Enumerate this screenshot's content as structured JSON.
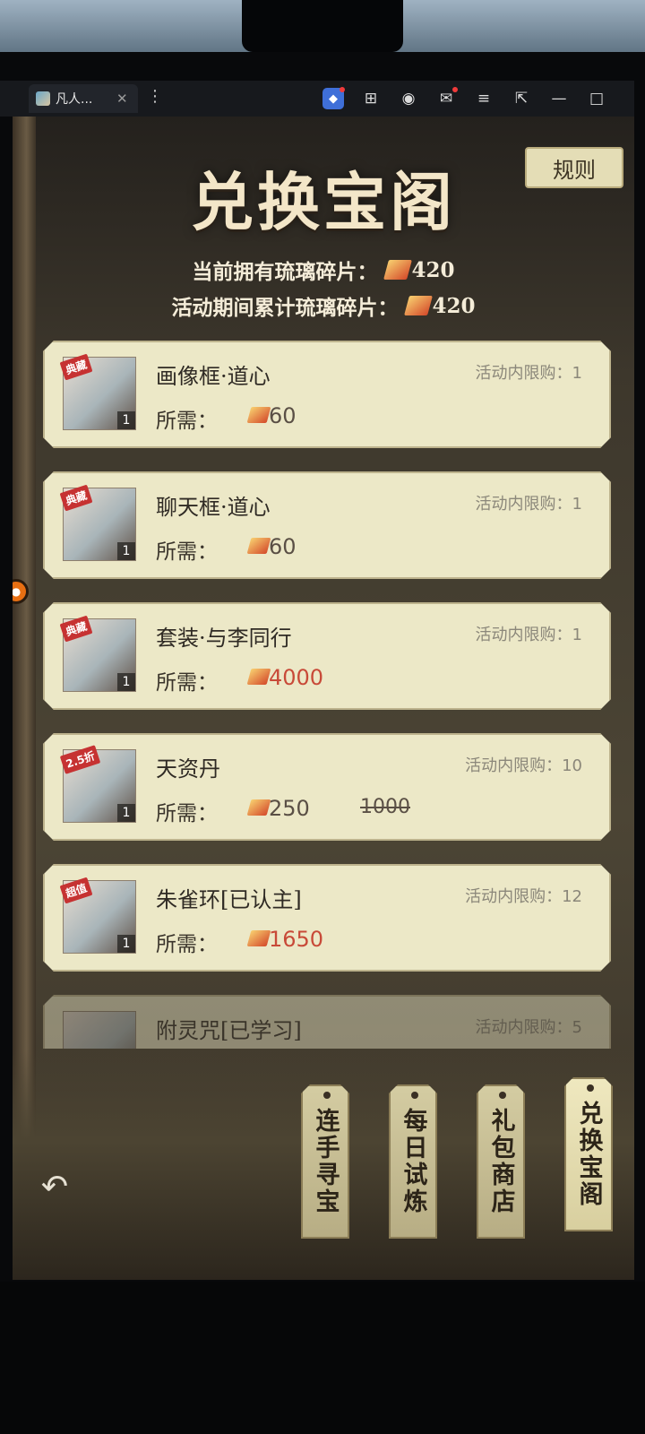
{
  "browser": {
    "tab_title": "凡人...",
    "tab_close": "✕",
    "more": "⋮",
    "icons": [
      "app-icon",
      "gamepad-icon",
      "profile-icon",
      "mail-icon",
      "menu-icon",
      "popout-icon",
      "minimize-icon",
      "maximize-icon"
    ]
  },
  "header": {
    "title": "兑换宝阁",
    "rules_label": "规则",
    "owned_label": "当前拥有琉璃碎片：",
    "owned_value": "420",
    "accumulated_label": "活动期间累计琉璃碎片：",
    "accumulated_value": "420"
  },
  "items": [
    {
      "name": "画像框·道心",
      "limit": "活动内限购：1",
      "price_label": "所需：",
      "price": "60",
      "count": "1",
      "badge": "典藏"
    },
    {
      "name": "聊天框·道心",
      "limit": "活动内限购：1",
      "price_label": "所需：",
      "price": "60",
      "count": "1",
      "badge": "典藏"
    },
    {
      "name": "套装·与李同行",
      "limit": "活动内限购：1",
      "price_label": "所需：",
      "price": "4000",
      "count": "1",
      "badge": "典藏"
    },
    {
      "name": "天资丹",
      "limit": "活动内限购：10",
      "price_label": "所需：",
      "price": "250",
      "original_price": "1000",
      "count": "1",
      "badge": "2.5折"
    },
    {
      "name": "朱雀环[已认主]",
      "limit": "活动内限购：12",
      "price_label": "所需：",
      "price": "1650",
      "count": "1",
      "badge": "超值"
    },
    {
      "name": "附灵咒[已学习]",
      "limit": "活动内限购：5"
    }
  ],
  "bottom_nav": [
    {
      "label": "连手寻宝"
    },
    {
      "label": "每日试炼"
    },
    {
      "label": "礼包商店"
    },
    {
      "label": "兑换宝阁",
      "active": true
    }
  ],
  "colors": {
    "card_bg": "#ece8c7",
    "title_text": "#f3e6c8",
    "price_red": "#c84a38"
  }
}
